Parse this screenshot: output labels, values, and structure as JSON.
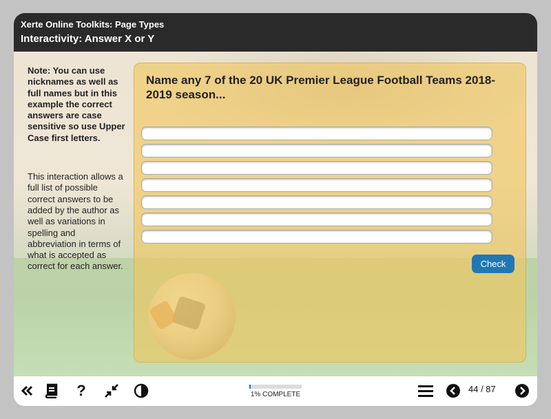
{
  "header": {
    "title": "Xerte Online Toolkits: Page Types",
    "subtitle": "Interactivity: Answer X or Y"
  },
  "sidebar": {
    "note": "Note: You can use nicknames as well as full names but in this example the correct answers are case sensitive so use Upper Case first letters.",
    "info": "This interaction allows a full list of possible correct answers to be added by the author as well as variations in spelling and abbreviation in terms of what is accepted as correct for each answer."
  },
  "question": {
    "text": "Name any 7 of the 20 UK Premier League Football Teams 2018-2019 season...",
    "answers": [
      "",
      "",
      "",
      "",
      "",
      "",
      ""
    ],
    "check_label": "Check"
  },
  "footer": {
    "progress_percent": 1,
    "progress_label": "1% COMPLETE",
    "page_count": "44 / 87",
    "icons": [
      "collapse-icon",
      "glossary-book-icon",
      "help-icon",
      "minimize-icon",
      "contrast-icon",
      "menu-icon",
      "previous-icon",
      "next-icon"
    ]
  },
  "colors": {
    "header_bg": "#2a2a2a",
    "panel_bg": "#f0c65c",
    "accent": "#1f78b4",
    "page_bg": "#c3c3c3"
  }
}
